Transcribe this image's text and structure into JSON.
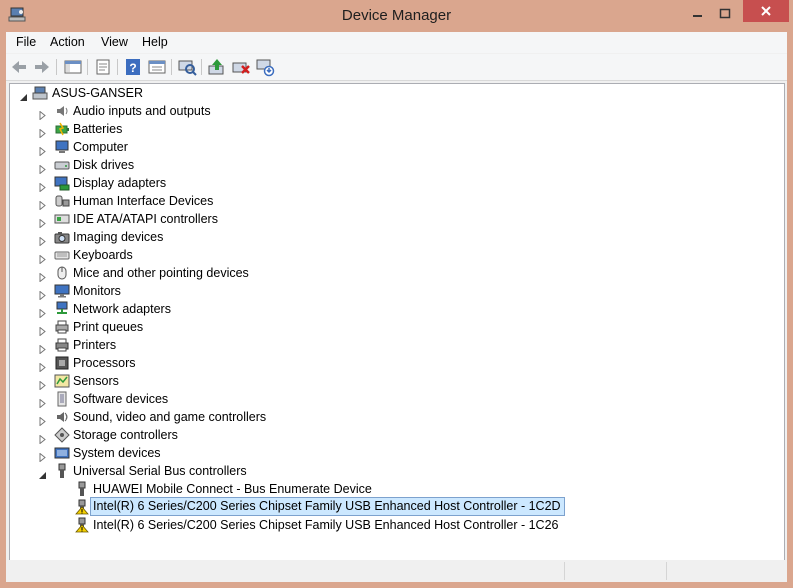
{
  "window": {
    "title": "Device Manager"
  },
  "menu": [
    "File",
    "Action",
    "View",
    "Help"
  ],
  "toolbar_icons": [
    "back-icon",
    "forward-icon",
    "show-hide-console-tree-icon",
    "properties-icon",
    "help-icon",
    "console-view-icon",
    "scan-hardware-icon",
    "update-driver-icon",
    "uninstall-device-icon",
    "disable-device-icon"
  ],
  "tree": {
    "root": "ASUS-GANSER",
    "categories": [
      {
        "label": "Audio inputs and outputs",
        "icon": "speaker-icon"
      },
      {
        "label": "Batteries",
        "icon": "battery-icon"
      },
      {
        "label": "Computer",
        "icon": "computer-icon"
      },
      {
        "label": "Disk drives",
        "icon": "disk-drive-icon"
      },
      {
        "label": "Display adapters",
        "icon": "display-adapter-icon"
      },
      {
        "label": "Human Interface Devices",
        "icon": "hid-icon"
      },
      {
        "label": "IDE ATA/ATAPI controllers",
        "icon": "ide-controller-icon"
      },
      {
        "label": "Imaging devices",
        "icon": "camera-icon"
      },
      {
        "label": "Keyboards",
        "icon": "keyboard-icon"
      },
      {
        "label": "Mice and other pointing devices",
        "icon": "mouse-icon"
      },
      {
        "label": "Monitors",
        "icon": "monitor-icon"
      },
      {
        "label": "Network adapters",
        "icon": "network-icon"
      },
      {
        "label": "Print queues",
        "icon": "print-queue-icon"
      },
      {
        "label": "Printers",
        "icon": "printer-icon"
      },
      {
        "label": "Processors",
        "icon": "processor-icon"
      },
      {
        "label": "Sensors",
        "icon": "sensor-icon"
      },
      {
        "label": "Software devices",
        "icon": "software-device-icon"
      },
      {
        "label": "Sound, video and game controllers",
        "icon": "sound-icon"
      },
      {
        "label": "Storage controllers",
        "icon": "storage-controller-icon"
      },
      {
        "label": "System devices",
        "icon": "system-device-icon"
      },
      {
        "label": "Universal Serial Bus controllers",
        "icon": "usb-icon",
        "expanded": true
      }
    ],
    "usb_children": [
      {
        "label": "HUAWEI Mobile Connect - Bus Enumerate Device",
        "warning": false,
        "selected": false
      },
      {
        "label": "Intel(R) 6 Series/C200 Series Chipset Family USB Enhanced Host Controller - 1C2D",
        "warning": true,
        "selected": true
      },
      {
        "label": "Intel(R) 6 Series/C200 Series Chipset Family USB Enhanced Host Controller - 1C26",
        "warning": true,
        "selected": false
      }
    ]
  },
  "colors": {
    "frame": "#daa68e",
    "close_button": "#c74f4f",
    "selection": "#cce8ff",
    "warning": "#f5d000"
  }
}
